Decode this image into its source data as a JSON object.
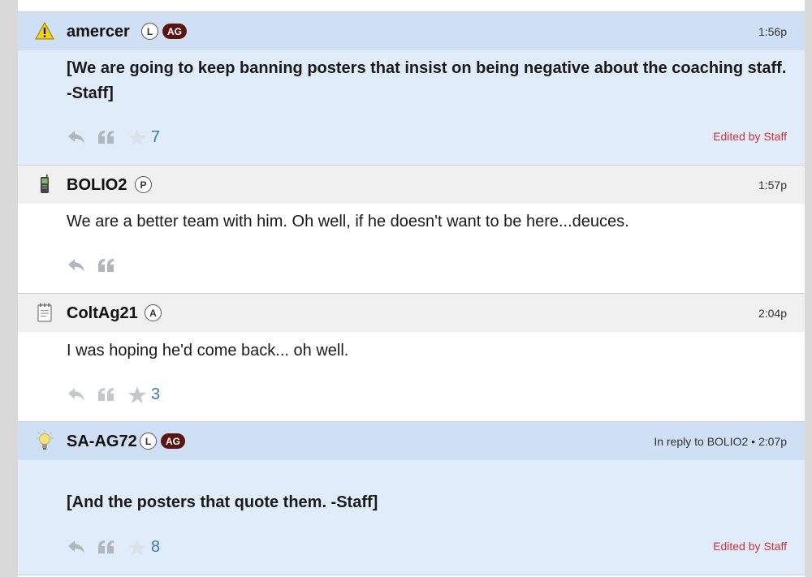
{
  "thread": {
    "posts": [
      {
        "username": "amercer",
        "badges": [
          "L",
          "AG"
        ],
        "timestamp": "1:56p",
        "avatar_icon": "warning-icon",
        "body": "[We are going to keep banning posters that insist on being negative about the coaching staff. -Staff]",
        "star_count": "7",
        "edited": "Edited by Staff"
      },
      {
        "username": "BOLIO2",
        "badges": [
          "P"
        ],
        "timestamp": "1:57p",
        "avatar_icon": "phone-icon",
        "body": "We are a better team with him. Oh well, if he doesn't want to be here...deuces."
      },
      {
        "username": "ColtAg21",
        "badges": [
          "A"
        ],
        "timestamp": "2:04p",
        "avatar_icon": "notepad-icon",
        "body": "I was hoping he'd come back... oh well.",
        "star_count": "3"
      },
      {
        "username": "SA-AG72",
        "badges": [
          "L",
          "AG"
        ],
        "timestamp": "In reply to BOLIO2 • 2:07p",
        "avatar_icon": "lightbulb-icon",
        "body": "[And the posters that quote them. -Staff]",
        "star_count": "8",
        "edited": "Edited by Staff"
      }
    ]
  },
  "colors": {
    "staff_header": "#cfe0f5",
    "staff_body": "#e1ecfa",
    "normal_header": "#f0f0f0",
    "ag_badge": "#5a1414",
    "star_count": "#3d78b5",
    "edited": "#c8323a"
  }
}
